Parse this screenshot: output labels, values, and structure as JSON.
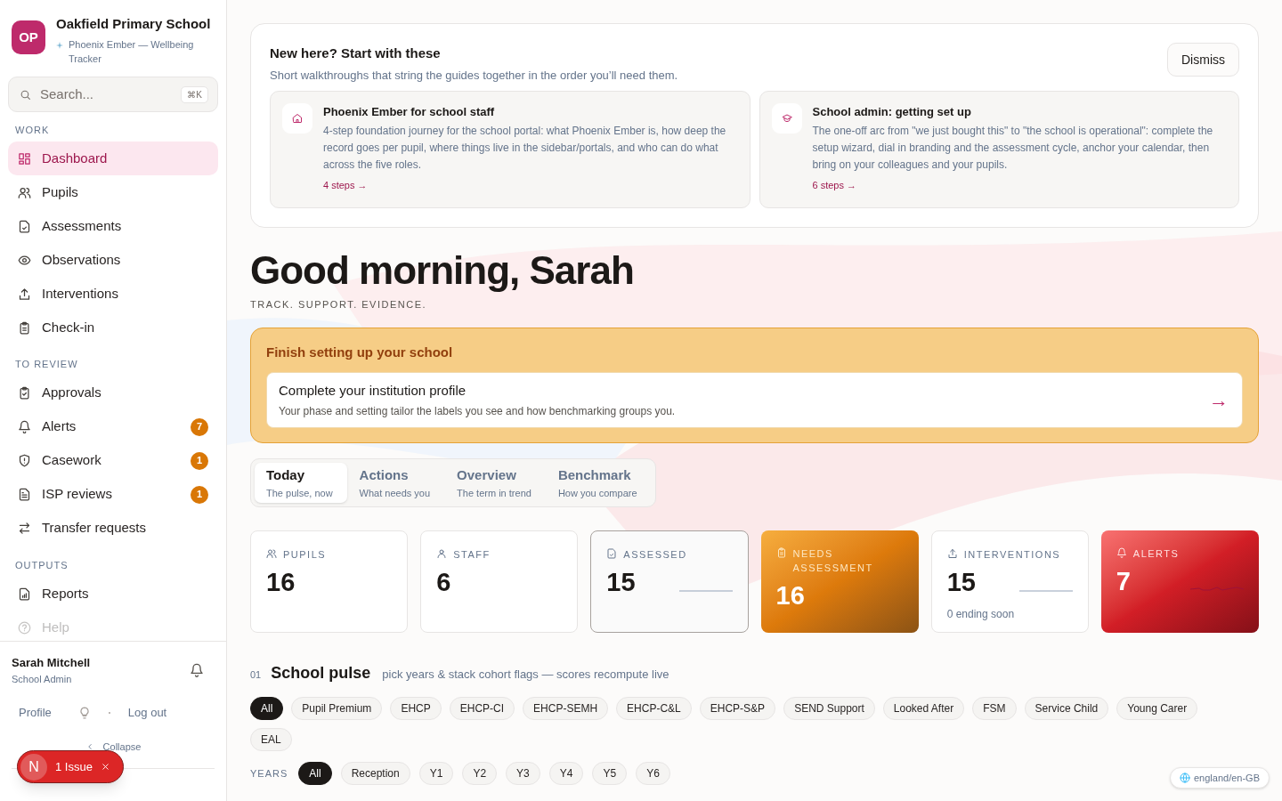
{
  "sidebar": {
    "logo": "OP",
    "school": "Oakfield Primary School",
    "product": "Phoenix Ember — Wellbeing Tracker",
    "search": {
      "placeholder": "Search...",
      "shortcut": "⌘K"
    },
    "sections": [
      {
        "title": "WORK",
        "items": [
          {
            "label": "Dashboard",
            "selected": true,
            "dimmed": false
          },
          {
            "label": "Pupils",
            "selected": false,
            "dimmed": false
          },
          {
            "label": "Assessments",
            "selected": false,
            "dimmed": false
          },
          {
            "label": "Observations",
            "selected": false,
            "dimmed": false
          },
          {
            "label": "Interventions",
            "selected": false,
            "dimmed": false
          },
          {
            "label": "Check-in",
            "selected": false,
            "dimmed": false
          }
        ]
      },
      {
        "title": "TO REVIEW",
        "items": [
          {
            "label": "Approvals",
            "selected": false,
            "dimmed": false
          },
          {
            "label": "Alerts",
            "selected": false,
            "dimmed": false,
            "badge": "7"
          },
          {
            "label": "Casework",
            "selected": false,
            "dimmed": false,
            "badge": "1"
          },
          {
            "label": "ISP reviews",
            "selected": false,
            "dimmed": false,
            "badge": "1"
          },
          {
            "label": "Transfer requests",
            "selected": false,
            "dimmed": false
          }
        ]
      },
      {
        "title": "OUTPUTS",
        "items": [
          {
            "label": "Reports",
            "selected": false,
            "dimmed": false
          },
          {
            "label": "Help",
            "selected": false,
            "dimmed": true
          }
        ]
      }
    ],
    "user": {
      "name": "Sarah Mitchell",
      "role": "School Admin"
    },
    "links": [
      "Profile",
      "Log out"
    ],
    "collapse": "Collapse"
  },
  "dev_overlay": {
    "logo": "N",
    "issues": "1 Issue"
  },
  "onboarding": {
    "title": "New here? Start with these",
    "subtitle": "Short walkthroughs that string the guides together in the order you’ll need them.",
    "dismiss": "Dismiss",
    "guides": [
      {
        "title": "Phoenix Ember for school staff",
        "description": "4-step foundation journey for the school portal: what Phoenix Ember is, how deep the record goes per pupil, where things live in the sidebar/portals, and who can do what across the five roles.",
        "steps": "4 steps →"
      },
      {
        "title": "School admin: getting set up",
        "description": "The one-off arc from \"we just bought this\" to \"the school is operational\": complete the setup wizard, dial in branding and the assessment cycle, anchor your calendar, then bring on your colleagues and your pupils.",
        "steps": "6 steps →"
      }
    ]
  },
  "greeting": "Good morning, Sarah",
  "tagline": "TRACK. SUPPORT. EVIDENCE.",
  "setup": {
    "title": "Finish setting up your school",
    "task": "Complete your institution profile",
    "description": "Your phase and setting tailor the labels you see and how benchmarking groups you.",
    "arrow": "→"
  },
  "tabs": [
    {
      "label": "Today",
      "hint": "The pulse, now",
      "selected": true
    },
    {
      "label": "Actions",
      "hint": "What needs you",
      "selected": false
    },
    {
      "label": "Overview",
      "hint": "The term in trend",
      "selected": false
    },
    {
      "label": "Benchmark",
      "hint": "How you compare",
      "selected": false
    }
  ],
  "stats": [
    {
      "label": "PUPILS",
      "value": "16",
      "kind": "plain",
      "sparkline": false
    },
    {
      "label": "STAFF",
      "value": "6",
      "kind": "plain",
      "sparkline": false
    },
    {
      "label": "ASSESSED",
      "value": "15",
      "kind": "outlined",
      "sparkline": true
    },
    {
      "label": "NEEDS ASSESSMENT",
      "value": "16",
      "kind": "warning",
      "sparkline": false
    },
    {
      "label": "INTERVENTIONS",
      "value": "15",
      "kind": "plain",
      "sparkline": true,
      "note": "0 ending soon"
    },
    {
      "label": "ALERTS",
      "value": "7",
      "kind": "danger",
      "sparkline": true
    }
  ],
  "pulse": {
    "number": "01",
    "title": "School pulse",
    "subtitle": "pick years & stack cohort flags — scores recompute live",
    "flags": [
      {
        "label": "All",
        "selected": true
      },
      {
        "label": "Pupil Premium",
        "selected": false
      },
      {
        "label": "EHCP",
        "selected": false
      },
      {
        "label": "EHCP-CI",
        "selected": false
      },
      {
        "label": "EHCP-SEMH",
        "selected": false
      },
      {
        "label": "EHCP-C&L",
        "selected": false
      },
      {
        "label": "EHCP-S&P",
        "selected": false
      },
      {
        "label": "SEND Support",
        "selected": false
      },
      {
        "label": "Looked After",
        "selected": false
      },
      {
        "label": "FSM",
        "selected": false
      },
      {
        "label": "Service Child",
        "selected": false
      },
      {
        "label": "Young Carer",
        "selected": false
      },
      {
        "label": "EAL",
        "selected": false
      }
    ],
    "years_label": "YEARS",
    "years": [
      {
        "label": "All",
        "selected": true
      },
      {
        "label": "Reception",
        "selected": false
      },
      {
        "label": "Y1",
        "selected": false
      },
      {
        "label": "Y2",
        "selected": false
      },
      {
        "label": "Y3",
        "selected": false
      },
      {
        "label": "Y4",
        "selected": false
      },
      {
        "label": "Y5",
        "selected": false
      },
      {
        "label": "Y6",
        "selected": false
      }
    ]
  },
  "locale": "england/en-GB"
}
